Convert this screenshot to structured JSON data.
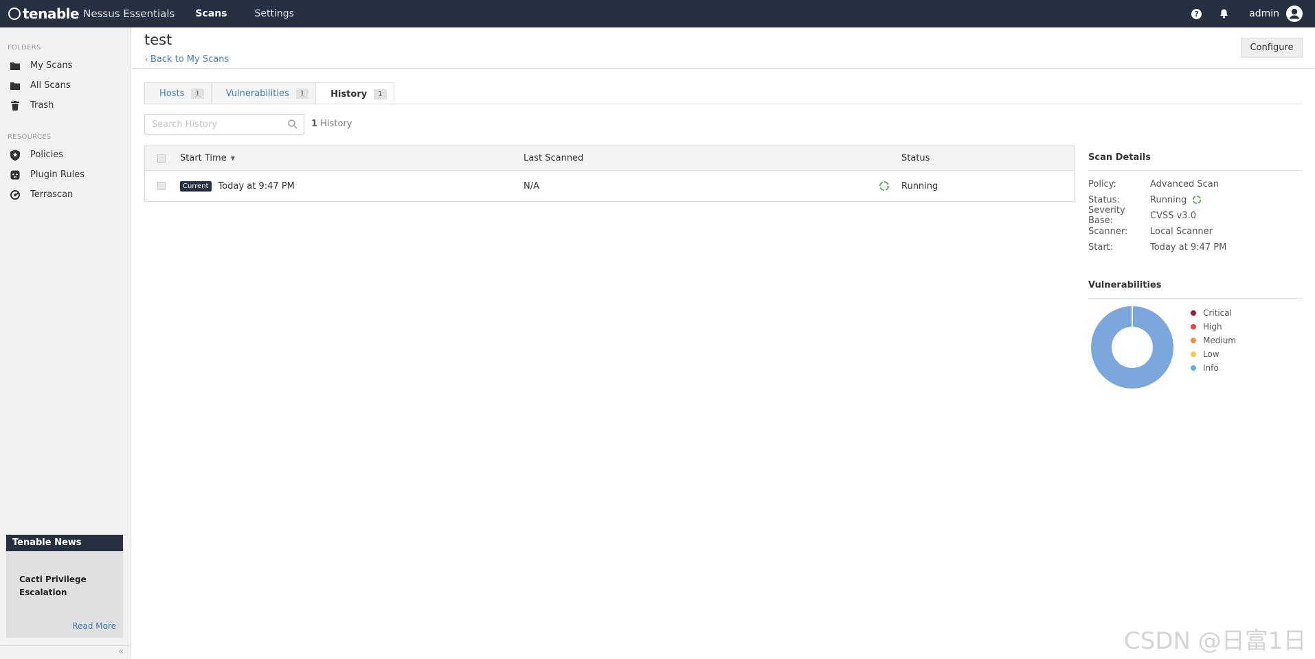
{
  "topbar": {
    "brand": "tenable",
    "product": "Nessus Essentials",
    "nav": [
      {
        "label": "Scans"
      },
      {
        "label": "Settings"
      }
    ],
    "help_icon": "question-icon",
    "user": "admin"
  },
  "sidebar": {
    "folders_label": "FOLDERS",
    "folders": [
      {
        "label": "My Scans",
        "icon": "folder-icon"
      },
      {
        "label": "All Scans",
        "icon": "folder-icon"
      },
      {
        "label": "Trash",
        "icon": "trash-icon"
      }
    ],
    "resources_label": "RESOURCES",
    "resources": [
      {
        "label": "Policies",
        "icon": "shield-star-icon"
      },
      {
        "label": "Plugin Rules",
        "icon": "plug-icon"
      },
      {
        "label": "Terrascan",
        "icon": "terrascan-icon"
      }
    ],
    "news": {
      "heading": "Tenable News",
      "title": "Cacti Privilege Escalation",
      "read_more": "Read More"
    },
    "collapse": "«"
  },
  "page": {
    "title": "test",
    "back": "Back to My Scans",
    "configure": "Configure"
  },
  "tabs": [
    {
      "label": "Hosts",
      "count": "1"
    },
    {
      "label": "Vulnerabilities",
      "count": "1"
    },
    {
      "label": "History",
      "count": "1"
    }
  ],
  "search": {
    "placeholder": "Search History",
    "count": "1",
    "count_label": "History"
  },
  "table": {
    "columns": [
      "Start Time",
      "Last Scanned",
      "Status"
    ],
    "rows": [
      {
        "badge": "Current",
        "start_time": "Today at 9:47 PM",
        "last_scanned": "N/A",
        "status": "Running"
      }
    ]
  },
  "scan_details": {
    "heading": "Scan Details",
    "rows": [
      {
        "key": "Policy:",
        "value": "Advanced Scan"
      },
      {
        "key": "Status:",
        "value": "Running"
      },
      {
        "key": "Severity Base:",
        "value": "CVSS v3.0"
      },
      {
        "key": "Scanner:",
        "value": "Local Scanner"
      },
      {
        "key": "Start:",
        "value": "Today at 9:47 PM"
      }
    ]
  },
  "vulnerabilities": {
    "heading": "Vulnerabilities",
    "legend": [
      {
        "label": "Critical",
        "color": "#91243e"
      },
      {
        "label": "High",
        "color": "#dd4b50"
      },
      {
        "label": "Medium",
        "color": "#f18c43"
      },
      {
        "label": "Low",
        "color": "#f8c851"
      },
      {
        "label": "Info",
        "color": "#67acdf"
      }
    ],
    "donut_color": "#7ba7dc"
  },
  "colors": {
    "topbar": "#263040",
    "link": "#3f7cbf",
    "running": "#4caf50"
  },
  "watermark": "CSDN @日富1日"
}
